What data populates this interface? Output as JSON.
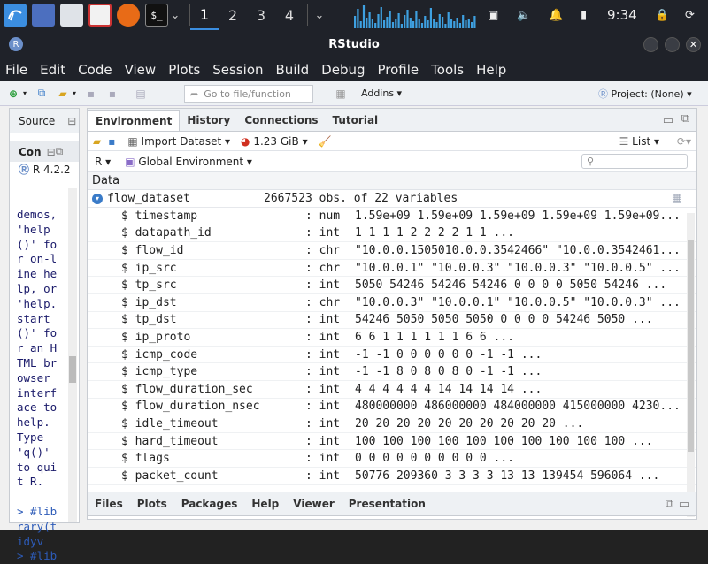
{
  "panel": {
    "workspaces": [
      "1",
      "2",
      "3",
      "4"
    ],
    "clock": "9:34"
  },
  "window": {
    "title": "RStudio",
    "menu": [
      "File",
      "Edit",
      "Code",
      "View",
      "Plots",
      "Session",
      "Build",
      "Debug",
      "Profile",
      "Tools",
      "Help"
    ]
  },
  "toolbar": {
    "goto_placeholder": "Go to file/function",
    "addins_label": "Addins",
    "project_label": "Project: (None)"
  },
  "left_pane": {
    "source_label": "Source",
    "console_label": "Con",
    "r_version": "R 4.2.2",
    "console_lines": [
      {
        "text": "demos,",
        "prompt": false
      },
      {
        "text": "'help",
        "prompt": false
      },
      {
        "text": "()' fo",
        "prompt": false
      },
      {
        "text": "r on-l",
        "prompt": false
      },
      {
        "text": "ine he",
        "prompt": false
      },
      {
        "text": "lp, or",
        "prompt": false
      },
      {
        "text": "'help.",
        "prompt": false
      },
      {
        "text": "start",
        "prompt": false
      },
      {
        "text": "()' fo",
        "prompt": false
      },
      {
        "text": "r an H",
        "prompt": false
      },
      {
        "text": "TML br",
        "prompt": false
      },
      {
        "text": "owser",
        "prompt": false
      },
      {
        "text": "interf",
        "prompt": false
      },
      {
        "text": "ace to",
        "prompt": false
      },
      {
        "text": "help.",
        "prompt": false
      },
      {
        "text": "Type",
        "prompt": false
      },
      {
        "text": "'q()'",
        "prompt": false
      },
      {
        "text": "to qui",
        "prompt": false
      },
      {
        "text": "t R.",
        "prompt": false
      },
      {
        "text": "",
        "prompt": false
      },
      {
        "text": "> #lib",
        "prompt": true
      },
      {
        "text": "rary(t",
        "prompt": true
      },
      {
        "text": "idyv",
        "prompt": true
      },
      {
        "text": "> #lib",
        "prompt": true
      }
    ]
  },
  "env_pane": {
    "tabs": [
      "Environment",
      "History",
      "Connections",
      "Tutorial"
    ],
    "import_label": "Import Dataset",
    "memory": "1.23 GiB",
    "list_label": "List",
    "lang": "R",
    "scope": "Global Environment",
    "search_placeholder": "",
    "data_header": "Data",
    "dataset": {
      "name": "flow_dataset",
      "summary": "2667523 obs. of 22 variables"
    },
    "variables": [
      {
        "name": "$ timestamp",
        "type": ": num",
        "values": "1.59e+09 1.59e+09 1.59e+09 1.59e+09 1.59e+09..."
      },
      {
        "name": "$ datapath_id",
        "type": ": int",
        "values": "1 1 1 1 2 2 2 2 1 1 ..."
      },
      {
        "name": "$ flow_id",
        "type": ": chr",
        "values": "\"10.0.0.1505010.0.0.3542466\" \"10.0.0.3542461..."
      },
      {
        "name": "$ ip_src",
        "type": ": chr",
        "values": "\"10.0.0.1\" \"10.0.0.3\" \"10.0.0.3\" \"10.0.0.5\" ..."
      },
      {
        "name": "$ tp_src",
        "type": ": int",
        "values": "5050 54246 54246 54246 0 0 0 0 5050 54246 ..."
      },
      {
        "name": "$ ip_dst",
        "type": ": chr",
        "values": "\"10.0.0.3\" \"10.0.0.1\" \"10.0.0.5\" \"10.0.0.3\" ..."
      },
      {
        "name": "$ tp_dst",
        "type": ": int",
        "values": "54246 5050 5050 5050 0 0 0 0 54246 5050 ..."
      },
      {
        "name": "$ ip_proto",
        "type": ": int",
        "values": "6 6 1 1 1 1 1 1 6 6 ..."
      },
      {
        "name": "$ icmp_code",
        "type": ": int",
        "values": "-1 -1 0 0 0 0 0 0 -1 -1 ..."
      },
      {
        "name": "$ icmp_type",
        "type": ": int",
        "values": "-1 -1 8 0 8 0 8 0 -1 -1 ..."
      },
      {
        "name": "$ flow_duration_sec",
        "type": ": int",
        "values": "4 4 4 4 4 4 14 14 14 14 ..."
      },
      {
        "name": "$ flow_duration_nsec",
        "type": ": int",
        "values": "480000000 486000000 484000000 415000000 4230..."
      },
      {
        "name": "$ idle_timeout",
        "type": ": int",
        "values": "20 20 20 20 20 20 20 20 20 20 ..."
      },
      {
        "name": "$ hard_timeout",
        "type": ": int",
        "values": "100 100 100 100 100 100 100 100 100 100 ..."
      },
      {
        "name": "$ flags",
        "type": ": int",
        "values": "0 0 0 0 0 0 0 0 0 0 ..."
      },
      {
        "name": "$ packet_count",
        "type": ": int",
        "values": "50776 209360 3 3 3 3 13 13 139454 596064 ..."
      }
    ]
  },
  "files_pane": {
    "tabs": [
      "Files",
      "Plots",
      "Packages",
      "Help",
      "Viewer",
      "Presentation"
    ]
  }
}
